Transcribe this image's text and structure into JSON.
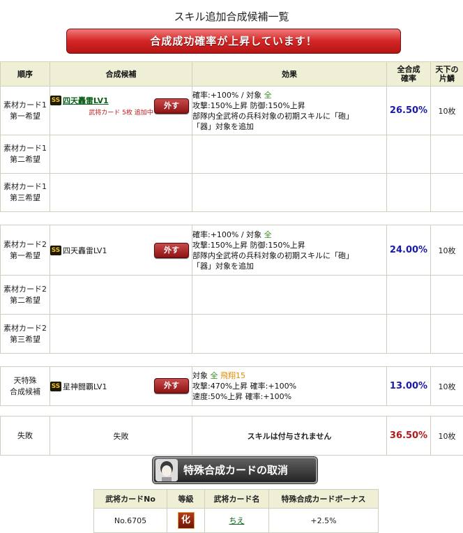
{
  "page": {
    "title": "スキル追加合成候補一覧",
    "banner": "合成成功確率が上昇しています！"
  },
  "table": {
    "headers": {
      "order": "順序",
      "candidate": "合成候補",
      "effect": "効果",
      "rate": "全合成確率",
      "count": "天下の片鱗"
    },
    "remove_label": "外す",
    "ss_badge": "SS",
    "group1": {
      "row1": {
        "order_line1": "素材カード1",
        "order_line2": "第一希望",
        "skill": "四天轟雷LV1",
        "note": "武将カード 5枚 追加中",
        "effect_line1_a": "確率:+100% / 対象",
        "effect_line1_b": "全",
        "effect_line2": "攻撃:150%上昇 防御:150%上昇",
        "effect_line3": "部隊内全武将の兵科対象の初期スキルに「砲」",
        "effect_line4": "「器」対象を追加",
        "rate": "26.50%",
        "count": "10枚"
      },
      "row2": {
        "order_line1": "素材カード1",
        "order_line2": "第二希望"
      },
      "row3": {
        "order_line1": "素材カード1",
        "order_line2": "第三希望"
      }
    },
    "group2": {
      "row1": {
        "order_line1": "素材カード2",
        "order_line2": "第一希望",
        "skill": "四天轟雷LV1",
        "effect_line1_a": "確率:+100% / 対象",
        "effect_line1_b": "全",
        "effect_line2": "攻撃:150%上昇 防御:150%上昇",
        "effect_line3": "部隊内全武将の兵科対象の初期スキルに「砲」",
        "effect_line4": "「器」対象を追加",
        "rate": "24.00%",
        "count": "10枚"
      },
      "row2": {
        "order_line1": "素材カード2",
        "order_line2": "第二希望"
      },
      "row3": {
        "order_line1": "素材カード2",
        "order_line2": "第三希望"
      }
    },
    "special": {
      "order_line1": "天特殊",
      "order_line2": "合成候補",
      "skill": "星神闘覇LV1",
      "effect_line1_a": "対象",
      "effect_line1_b": "全",
      "effect_line1_c": "飛翔15",
      "effect_line2": "攻撃:470%上昇 確率:+100%",
      "effect_line3": "速度:50%上昇 確率:+100%",
      "rate": "13.00%",
      "count": "10枚"
    },
    "fail": {
      "order": "失敗",
      "candidate": "失敗",
      "effect": "スキルは付与されません",
      "rate": "36.50%",
      "count": "10枚"
    }
  },
  "cancel_button": "特殊合成カードの取消",
  "bonus": {
    "headers": [
      "武将カードNo",
      "等級",
      "武将カード名",
      "特殊合成カードボーナス"
    ],
    "row": {
      "no": "No.6705",
      "grade": "化",
      "name": "ちえ",
      "bonus": "+2.5%"
    }
  },
  "colors": {
    "banner_red": "#d42525",
    "header_bg": "#efefd6",
    "rate_blue": "#1a1aa6",
    "rate_red": "#b01a1a",
    "target_green": "#3a8a1a",
    "target_orange": "#e08a00"
  }
}
